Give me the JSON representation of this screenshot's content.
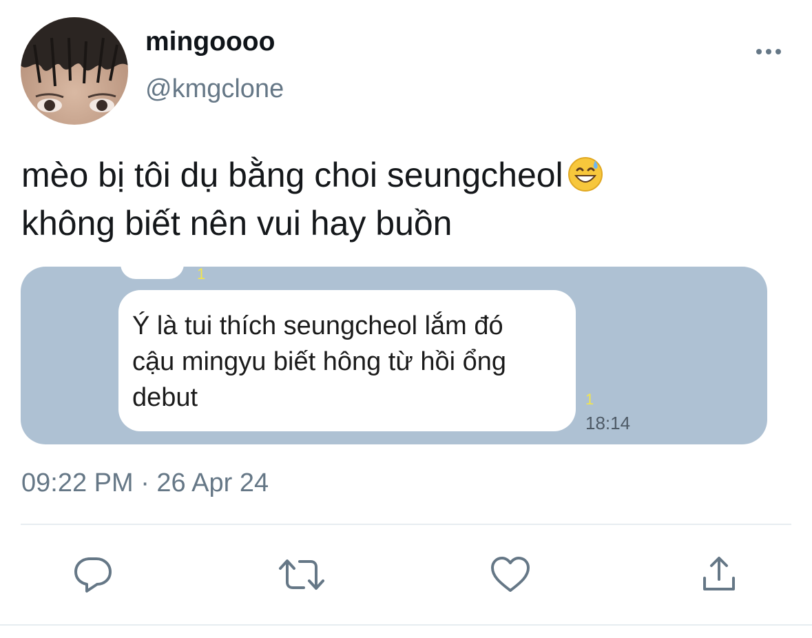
{
  "user": {
    "display_name": "mingoooo",
    "handle": "@kmgclone"
  },
  "tweet": {
    "text_line1": "mèo bị tôi dụ bằng choi seungcheol",
    "text_line2": "không biết nên vui hay buồn",
    "emoji": "grinning-face-with-sweat-emoji",
    "timestamp": "09:22 PM · 26 Apr 24"
  },
  "media": {
    "prev_read_count": "1",
    "message_line1": "Ý là tui thích seungcheol lắm đó",
    "message_line2": "cậu mingyu biết hông từ hồi ổng",
    "message_line3": "debut",
    "read_count": "1",
    "message_time": "18:14",
    "chat_background": "#aec1d3"
  },
  "actions": {
    "reply_icon": "reply-icon",
    "retweet_icon": "retweet-icon",
    "like_icon": "heart-icon",
    "share_icon": "share-icon"
  },
  "colors": {
    "text": "#14171a",
    "secondary": "#657786",
    "icon": "#657786",
    "divider": "#e6ecf0"
  }
}
